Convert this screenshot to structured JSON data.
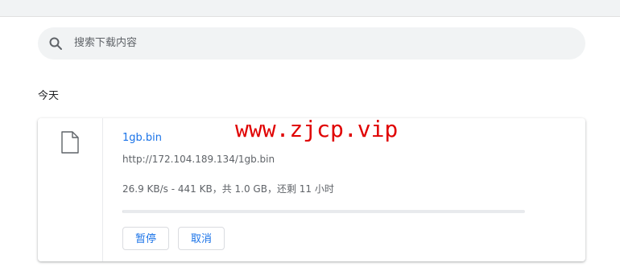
{
  "search": {
    "placeholder": "搜索下载内容"
  },
  "section": {
    "title": "今天"
  },
  "download": {
    "filename": "1gb.bin",
    "url": "http://172.104.189.134/1gb.bin",
    "status": "26.9 KB/s - 441 KB，共 1.0 GB，还剩 11 小时",
    "progress_fraction": 0.0004,
    "pause_label": "暂停",
    "cancel_label": "取消",
    "file_icon": "file-icon"
  },
  "watermark": {
    "text": "www.zjcp.vip"
  },
  "colors": {
    "accent": "#1a73e8",
    "watermark": "#e00000"
  }
}
